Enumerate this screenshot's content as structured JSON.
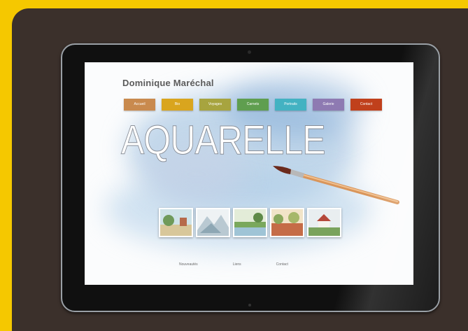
{
  "site": {
    "title": "Dominique Maréchal",
    "hero_title": "AQUARELLE"
  },
  "nav": {
    "items": [
      {
        "label": "Accueil",
        "color": "#c98a4e"
      },
      {
        "label": "Bio",
        "color": "#d9a51e"
      },
      {
        "label": "Voyages",
        "color": "#a7a43f"
      },
      {
        "label": "Carnets",
        "color": "#5f9e4f"
      },
      {
        "label": "Portraits",
        "color": "#43b2c2"
      },
      {
        "label": "Galerie",
        "color": "#8e7ab2"
      },
      {
        "label": "Contact",
        "color": "#c0401c"
      }
    ]
  },
  "gallery": {
    "thumbnails": [
      "seaside-watercolor",
      "mountain-sketch",
      "river-landscape",
      "garden-watercolor",
      "chapel-watercolor"
    ]
  },
  "footer": {
    "links": [
      "Nouveautés",
      "Liens",
      "Contact"
    ]
  }
}
